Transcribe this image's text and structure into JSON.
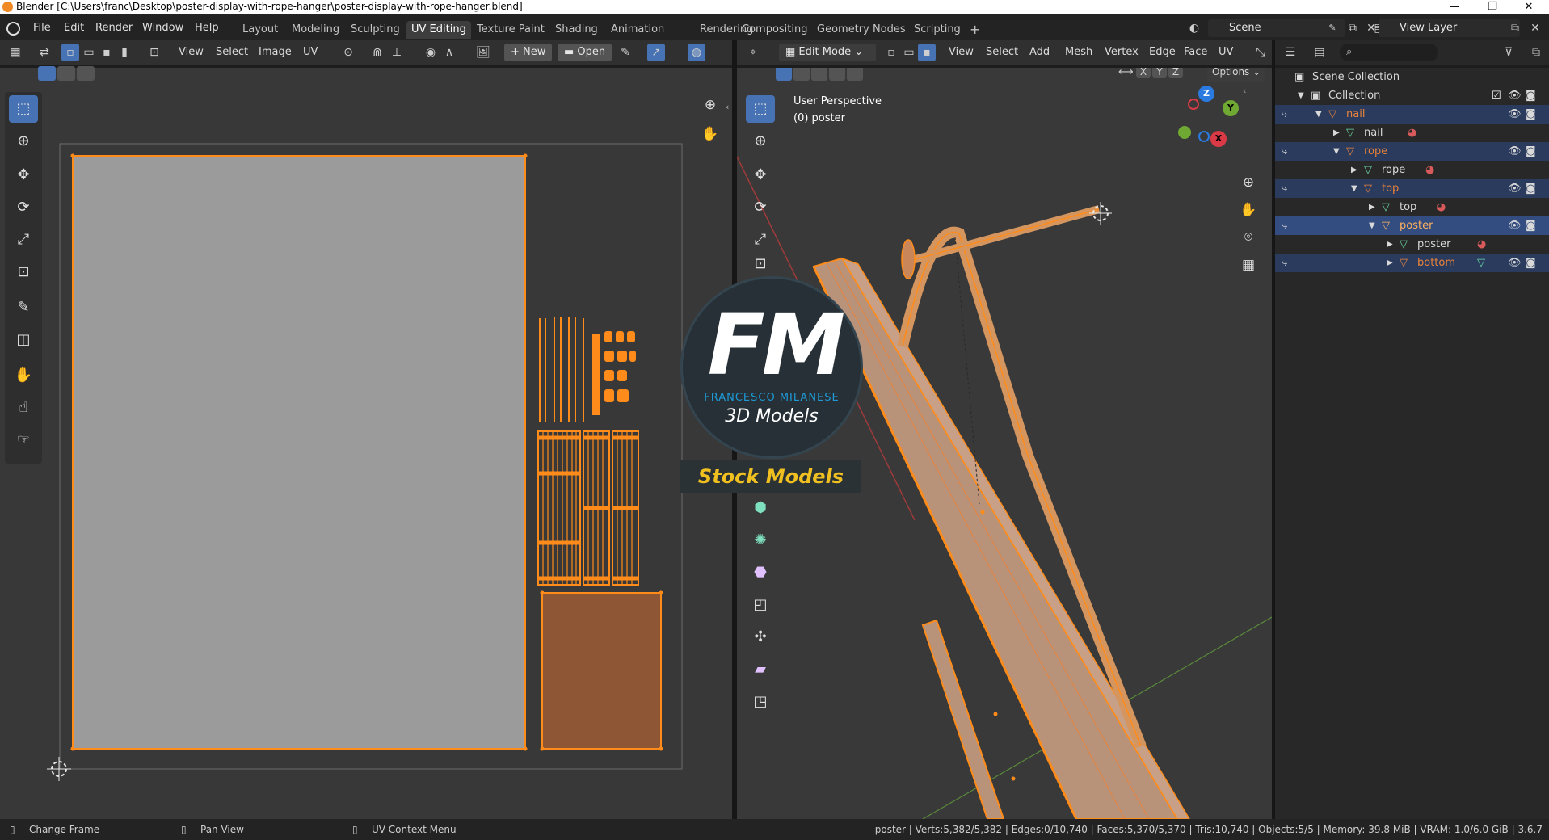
{
  "window": {
    "title": "Blender [C:\\Users\\franc\\Desktop\\poster-display-with-rope-hanger\\poster-display-with-rope-hanger.blend]",
    "minimize": "—",
    "restore": "❐",
    "close": "✕"
  },
  "menu": [
    "File",
    "Edit",
    "Render",
    "Window",
    "Help"
  ],
  "workspaces": [
    "Layout",
    "Modeling",
    "Sculpting",
    "UV Editing",
    "Texture Paint",
    "Shading",
    "Animation",
    "Rendering",
    "Compositing",
    "Geometry Nodes",
    "Scripting"
  ],
  "active_workspace": "UV Editing",
  "add_workspace": "+",
  "scene_field": "Scene",
  "view_layer_field": "View Layer",
  "uv_header": {
    "view": "View",
    "select": "Select",
    "image": "Image",
    "uv": "UV",
    "new_btn": "New",
    "open_btn": "Open"
  },
  "viewport_header": {
    "mode": "Edit Mode",
    "view": "View",
    "select": "Select",
    "add": "Add",
    "mesh": "Mesh",
    "vertex": "Vertex",
    "edge": "Edge",
    "face": "Face",
    "uv": "UV",
    "x": "X",
    "y": "Y",
    "z": "Z",
    "options": "Options"
  },
  "viewport_overlay": {
    "perspective": "User Perspective",
    "object": "(0) poster"
  },
  "gizmo": {
    "z": "Z",
    "y": "Y",
    "x": "X"
  },
  "watermark": {
    "logo": "FM",
    "author": "FRANCESCO MILANESE",
    "product": "3D Models",
    "banner": "Stock Models"
  },
  "outliner": {
    "scene_collection": "Scene Collection",
    "rows": [
      {
        "label": "Collection",
        "indent": 1,
        "type": "collection"
      },
      {
        "label": "nail",
        "indent": 2,
        "type": "object",
        "highlight": true
      },
      {
        "label": "nail",
        "indent": 3,
        "type": "mesh"
      },
      {
        "label": "rope",
        "indent": 3,
        "type": "object",
        "highlight": true
      },
      {
        "label": "rope",
        "indent": 4,
        "type": "mesh"
      },
      {
        "label": "top",
        "indent": 4,
        "type": "object",
        "highlight": true
      },
      {
        "label": "top",
        "indent": 5,
        "type": "mesh"
      },
      {
        "label": "poster",
        "indent": 5,
        "type": "object",
        "highlight": true,
        "active": true
      },
      {
        "label": "poster",
        "indent": 6,
        "type": "mesh"
      },
      {
        "label": "bottom",
        "indent": 6,
        "type": "object",
        "highlight": true
      }
    ]
  },
  "statusbar": {
    "left1": "Change Frame",
    "left2": "Pan View",
    "left3": "UV Context Menu",
    "stats": "poster | Verts:5,382/5,382 | Edges:0/10,740 | Faces:5,370/5,370 | Tris:10,740 | Objects:5/5 | Memory: 39.8 MiB | VRAM: 1.0/6.0 GiB | 3.6.7"
  },
  "colors": {
    "accent": "#4772b3",
    "selection_orange": "#ff8c1a",
    "object_orange": "#e8823a",
    "uv_grey": "#9b9b9b",
    "watermark_blue": "#1e9ad6",
    "banner_yellow": "#f0c020"
  }
}
